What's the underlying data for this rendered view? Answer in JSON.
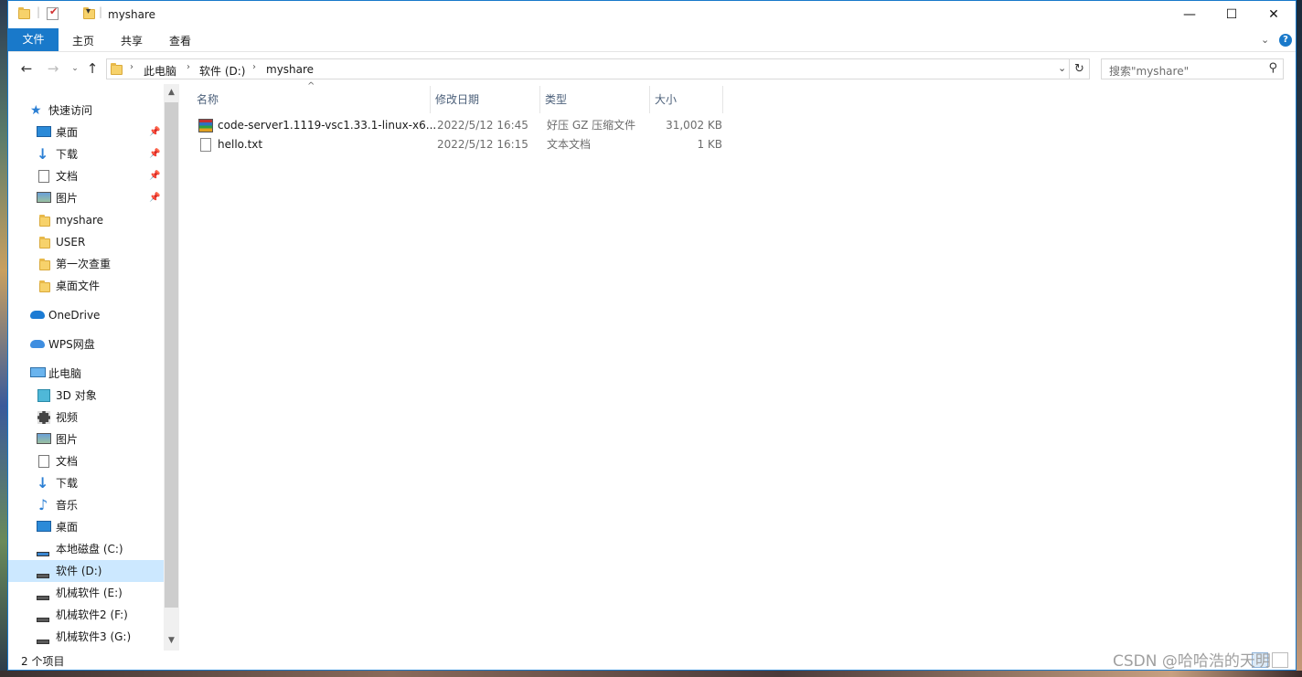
{
  "window": {
    "title": "myshare",
    "controls": {
      "minimize": "—",
      "maximize": "☐",
      "close": "✕"
    }
  },
  "ribbon": {
    "tabs": [
      {
        "label": "文件"
      },
      {
        "label": "主页"
      },
      {
        "label": "共享"
      },
      {
        "label": "查看"
      }
    ]
  },
  "address": {
    "crumbs": [
      "此电脑",
      "软件 (D:)",
      "myshare"
    ],
    "search_placeholder": "搜索\"myshare\""
  },
  "nav_pane": {
    "items": [
      {
        "label": "快速访问",
        "icon": "star-icon",
        "pinned": false
      },
      {
        "label": "桌面",
        "icon": "desktop-icon",
        "pinned": true
      },
      {
        "label": "下载",
        "icon": "download-icon",
        "pinned": true
      },
      {
        "label": "文档",
        "icon": "document-icon",
        "pinned": true
      },
      {
        "label": "图片",
        "icon": "picture-icon",
        "pinned": true
      },
      {
        "label": "myshare",
        "icon": "folder-icon",
        "pinned": false
      },
      {
        "label": "USER",
        "icon": "folder-icon",
        "pinned": false
      },
      {
        "label": "第一次查重",
        "icon": "folder-icon",
        "pinned": false
      },
      {
        "label": "桌面文件",
        "icon": "folder-icon",
        "pinned": false
      },
      {
        "label": "OneDrive",
        "icon": "cloud-icon",
        "pinned": false
      },
      {
        "label": "WPS网盘",
        "icon": "cloud-icon",
        "pinned": false
      },
      {
        "label": "此电脑",
        "icon": "computer-icon",
        "pinned": false
      },
      {
        "label": "3D 对象",
        "icon": "cube-icon",
        "pinned": false
      },
      {
        "label": "视频",
        "icon": "video-icon",
        "pinned": false
      },
      {
        "label": "图片",
        "icon": "picture-icon",
        "pinned": false
      },
      {
        "label": "文档",
        "icon": "document-icon",
        "pinned": false
      },
      {
        "label": "下载",
        "icon": "download-icon",
        "pinned": false
      },
      {
        "label": "音乐",
        "icon": "music-icon",
        "pinned": false
      },
      {
        "label": "桌面",
        "icon": "desktop-icon",
        "pinned": false
      },
      {
        "label": "本地磁盘 (C:)",
        "icon": "drive-icon",
        "pinned": false
      },
      {
        "label": "软件 (D:)",
        "icon": "drive-icon",
        "pinned": false,
        "selected": true
      },
      {
        "label": "机械软件 (E:)",
        "icon": "drive-icon",
        "pinned": false
      },
      {
        "label": "机械软件2 (F:)",
        "icon": "drive-icon",
        "pinned": false
      },
      {
        "label": "机械软件3 (G:)",
        "icon": "drive-icon",
        "pinned": false
      }
    ]
  },
  "file_list": {
    "columns": [
      "名称",
      "修改日期",
      "类型",
      "大小"
    ],
    "rows": [
      {
        "name": "code-server1.1119-vsc1.33.1-linux-x6...",
        "date": "2022/5/12 16:45",
        "type": "好压 GZ 压缩文件",
        "size": "31,002 KB",
        "icon": "archive-icon"
      },
      {
        "name": "hello.txt",
        "date": "2022/5/12 16:15",
        "type": "文本文档",
        "size": "1 KB",
        "icon": "text-file-icon"
      }
    ]
  },
  "status": {
    "item_count": "2 个项目"
  },
  "watermark": "CSDN @哈哈浩的天明",
  "colors": {
    "accent": "#1979ca",
    "selection": "#cce8ff",
    "folder": "#f7d26b"
  }
}
